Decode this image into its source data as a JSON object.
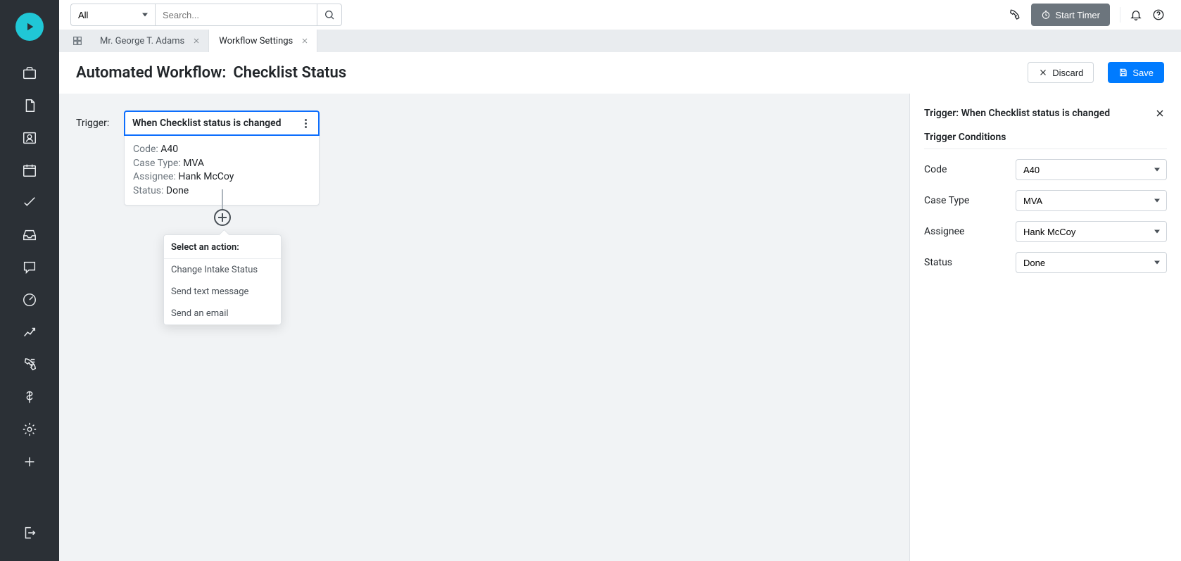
{
  "topbar": {
    "filter_value": "All",
    "search_placeholder": "Search...",
    "timer_label": "Start Timer"
  },
  "tabs": [
    {
      "label": "Mr. George T. Adams",
      "active": false
    },
    {
      "label": "Workflow Settings",
      "active": true
    }
  ],
  "page": {
    "prefix": "Automated Workflow:",
    "title": "Checklist Status",
    "discard_label": "Discard",
    "save_label": "Save"
  },
  "trigger": {
    "label": "Trigger:",
    "head": "When Checklist status is changed",
    "rows": [
      {
        "label": "Code:",
        "value": "A40"
      },
      {
        "label": "Case Type:",
        "value": "MVA"
      },
      {
        "label": "Assignee:",
        "value": "Hank McCoy"
      },
      {
        "label": "Status:",
        "value": "Done"
      }
    ]
  },
  "action_menu": {
    "title": "Select an action:",
    "items": [
      "Change Intake Status",
      "Send text message",
      "Send an email"
    ]
  },
  "side_panel": {
    "title": "Trigger: When Checklist status is changed",
    "section": "Trigger Conditions",
    "fields": [
      {
        "label": "Code",
        "value": "A40"
      },
      {
        "label": "Case Type",
        "value": "MVA"
      },
      {
        "label": "Assignee",
        "value": "Hank McCoy"
      },
      {
        "label": "Status",
        "value": "Done"
      }
    ]
  }
}
